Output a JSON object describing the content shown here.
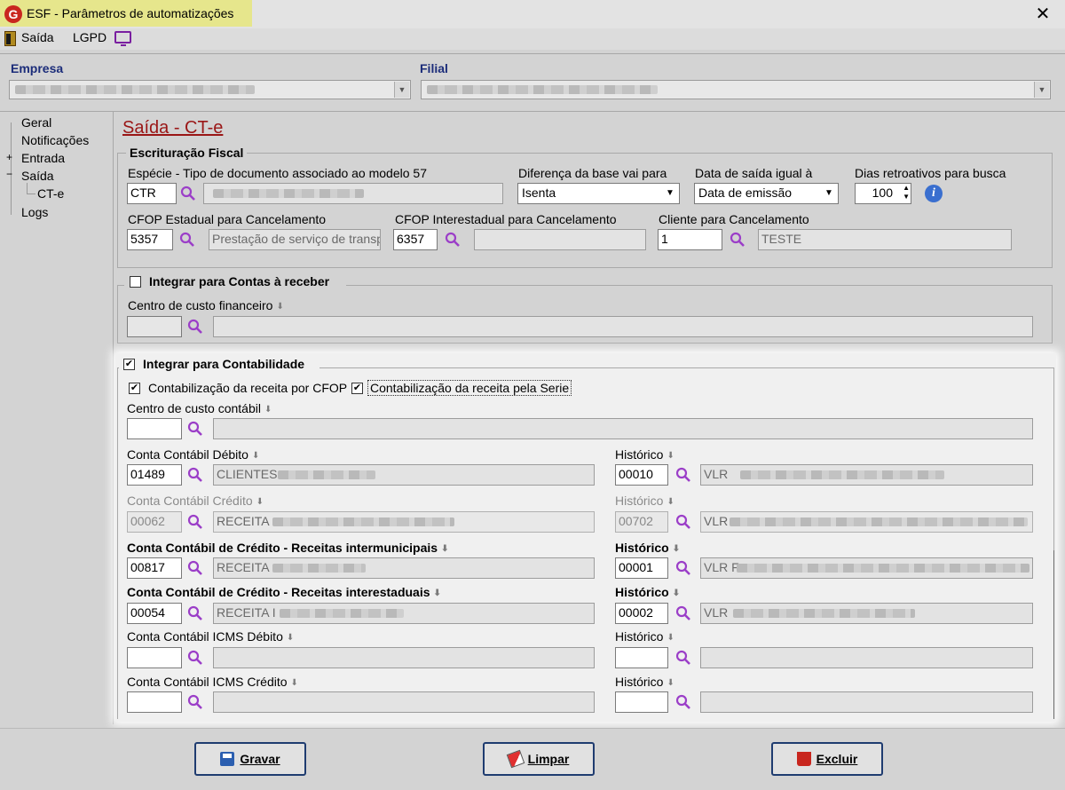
{
  "window": {
    "title": "ESF - Parâmetros de automatizações",
    "logo_letter": "G",
    "close_glyph": "✕"
  },
  "menu": {
    "exit_label": "Saída",
    "lgpd_label": "LGPD"
  },
  "header": {
    "company_label": "Empresa",
    "branch_label": "Filial"
  },
  "nav_tree": {
    "items": [
      {
        "label": "Geral"
      },
      {
        "label": "Notificações"
      },
      {
        "label": "Entrada",
        "expander": "+"
      },
      {
        "label": "Saída",
        "expander": "−"
      },
      {
        "label": "CT-e"
      },
      {
        "label": "Logs"
      }
    ]
  },
  "section_title": "Saída - CT-e",
  "fiscal": {
    "group_label": "Escrituração Fiscal",
    "species_label": "Espécie - Tipo de documento associado ao modelo 57",
    "species_code": "CTR",
    "base_diff_label": "Diferença da base vai para",
    "base_diff_value": "Isenta",
    "exit_date_label": "Data de saída igual à",
    "exit_date_value": "Data de emissão",
    "retro_days_label": "Dias retroativos para busca",
    "retro_days_value": "100",
    "cfop_state_label": "CFOP Estadual para  Cancelamento",
    "cfop_state_code": "5357",
    "cfop_state_desc": "Prestação de serviço de transpo",
    "cfop_inter_label": "CFOP Interestadual para  Cancelamento",
    "cfop_inter_code": "6357",
    "cancel_client_label": "Cliente para Cancelamento",
    "cancel_client_code": "1",
    "cancel_client_name": "TESTE"
  },
  "receivables": {
    "group_label": "Integrar para Contas à receber",
    "checked": false,
    "cost_center_label": "Centro de custo financeiro"
  },
  "accounting": {
    "group_label": "Integrar para Contabilidade",
    "checked": true,
    "by_cfop_label": "Contabilização da receita por CFOP",
    "by_serie_label": "Contabilização da receita pela Serie",
    "cost_center_label": "Centro de custo contábil",
    "debit_label": "Conta Contábil Débito",
    "debit_code": "01489",
    "debit_name": "CLIENTES",
    "debit_hist_label": "Histórico",
    "debit_hist_code": "00010",
    "debit_hist_text": "VLR",
    "credit_label": "Conta Contábil Crédito",
    "credit_code": "00062",
    "credit_name": "RECEITA",
    "credit_hist_label": "Histórico",
    "credit_hist_code": "00702",
    "credit_hist_text": "VLR",
    "intermun_label": "Conta Contábil de Crédito - Receitas intermunicipais",
    "intermun_code": "00817",
    "intermun_name": "RECEITA",
    "intermun_hist_label": "Histórico",
    "intermun_hist_code": "00001",
    "intermun_hist_text": "VLR F",
    "interstate_label": "Conta Contábil de Crédito - Receitas interestaduais",
    "interstate_code": "00054",
    "interstate_name": "RECEITA I",
    "interstate_hist_label": "Histórico",
    "interstate_hist_code": "00002",
    "interstate_hist_text": "VLR",
    "icms_debit_label": "Conta Contábil ICMS Débito",
    "icms_debit_hist_label": "Histórico",
    "icms_credit_label": "Conta Contábil ICMS Crédito",
    "icms_credit_hist_label": "Histórico"
  },
  "buttons": {
    "save_label": "Gravar",
    "clear_label": "Limpar",
    "delete_label": "Excluir"
  },
  "colors": {
    "title_highlight": "#e6e68c",
    "section_title": "#9a1616",
    "header_label": "#1c2d7a",
    "search_icon": "#9b3ec8",
    "button_border": "#1f3c70"
  }
}
